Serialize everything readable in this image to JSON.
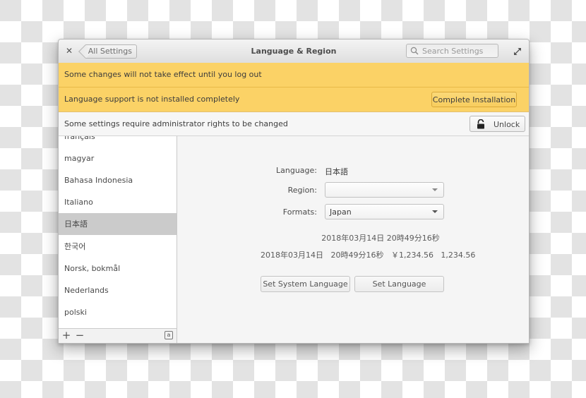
{
  "window": {
    "title": "Language & Region",
    "back_label": "All Settings",
    "search_placeholder": "Search Settings"
  },
  "infobars": {
    "logout_message": "Some changes will not take effect until you log out",
    "support_message": "Language support is not installed completely",
    "complete_install_label": "Complete Installation",
    "admin_message": "Some settings require administrator rights to be changed",
    "unlock_label": "Unlock"
  },
  "colors": {
    "warning_bar": "#fbd266",
    "selected_row": "#cbcbcb"
  },
  "sidebar": {
    "languages": [
      {
        "label": "français",
        "selected": false
      },
      {
        "label": "magyar",
        "selected": false
      },
      {
        "label": "Bahasa Indonesia",
        "selected": false
      },
      {
        "label": "Italiano",
        "selected": false
      },
      {
        "label": "日本語",
        "selected": true
      },
      {
        "label": "한국어",
        "selected": false
      },
      {
        "label": "Norsk, bokmål",
        "selected": false
      },
      {
        "label": "Nederlands",
        "selected": false
      },
      {
        "label": "polski",
        "selected": false
      }
    ],
    "footer": {
      "add_label": "+",
      "remove_label": "−",
      "keyboard_label": "a"
    }
  },
  "main": {
    "language_label": "Language:",
    "language_value": "日本語",
    "region_label": "Region:",
    "region_value": "",
    "formats_label": "Formats:",
    "formats_value": "Japan",
    "datetime_preview": "2018年03月14日 20時49分16秒",
    "formats_preview": "2018年03月14日   20時49分16秒   ￥1,234.56   1,234.56",
    "set_system_language_label": "Set System Language",
    "set_language_label": "Set Language"
  }
}
